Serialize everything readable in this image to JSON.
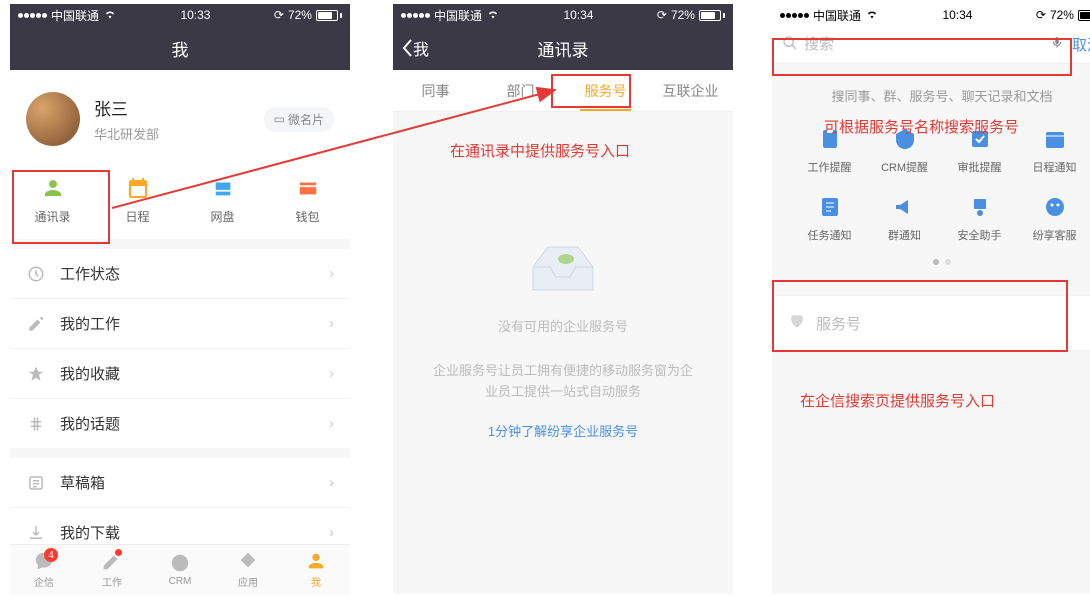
{
  "statusbar": {
    "carrier": "中国联通",
    "time1": "10:33",
    "time2": "10:34",
    "time3": "10:34",
    "battery": "72%",
    "loading": "⟳"
  },
  "screen1": {
    "title": "我",
    "profile": {
      "name": "张三",
      "dept": "华北研发部",
      "card_btn": "微名片"
    },
    "quick": [
      {
        "label": "通讯录"
      },
      {
        "label": "日程"
      },
      {
        "label": "网盘"
      },
      {
        "label": "钱包"
      }
    ],
    "rows_a": [
      {
        "label": "工作状态"
      },
      {
        "label": "我的工作"
      },
      {
        "label": "我的收藏"
      },
      {
        "label": "我的话题"
      }
    ],
    "rows_b": [
      {
        "label": "草稿箱"
      },
      {
        "label": "我的下载"
      }
    ],
    "tabs": [
      {
        "label": "企信",
        "badge": "4"
      },
      {
        "label": "工作"
      },
      {
        "label": "CRM"
      },
      {
        "label": "应用"
      },
      {
        "label": "我"
      }
    ]
  },
  "screen2": {
    "back": "我",
    "title": "通讯录",
    "subtabs": [
      "同事",
      "部门",
      "服务号",
      "互联企业"
    ],
    "empty_title": "没有可用的企业服务号",
    "empty_desc1": "企业服务号让员工拥有便捷的移动服务窗为企",
    "empty_desc2": "业员工提供一站式自动服务",
    "empty_link": "1分钟了解纷享企业服务号"
  },
  "screen3": {
    "search_placeholder": "搜索",
    "cancel": "取消",
    "hint": "搜同事、群、服务号、聊天记录和文档",
    "services": [
      "工作提醒",
      "CRM提醒",
      "审批提醒",
      "日程通知",
      "任务通知",
      "群通知",
      "安全助手",
      "纷享客服"
    ],
    "section_label": "服务号"
  },
  "annotations": {
    "a1": "在通讯录中提供服务号入口",
    "a2": "可根据服务号名称搜索服务号",
    "a3": "在企信搜索页提供服务号入口"
  }
}
